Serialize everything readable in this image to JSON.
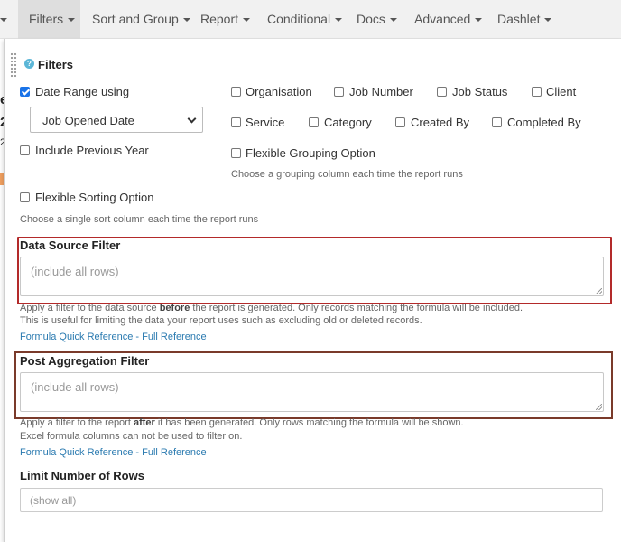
{
  "menubar": {
    "items": [
      {
        "label": "Filters"
      },
      {
        "label": "Sort and Group"
      },
      {
        "label": "Report"
      },
      {
        "label": "Conditional"
      },
      {
        "label": "Docs"
      },
      {
        "label": "Advanced"
      },
      {
        "label": "Dashlet"
      }
    ]
  },
  "panel": {
    "title": "Filters",
    "date_range": {
      "label": "Date Range using",
      "checked": true,
      "selected": "Job Opened Date"
    },
    "include_previous_year": "Include Previous Year",
    "flexible_sorting": "Flexible Sorting Option",
    "flexible_sorting_help": "Choose a single sort column each time the report runs",
    "columns": [
      {
        "label": "Organisation"
      },
      {
        "label": "Job Number"
      },
      {
        "label": "Job Status"
      },
      {
        "label": "Client"
      },
      {
        "label": "Service"
      },
      {
        "label": "Category"
      },
      {
        "label": "Created By"
      },
      {
        "label": "Completed By"
      }
    ],
    "flexible_grouping": "Flexible Grouping Option",
    "flexible_grouping_help": "Choose a grouping column each time the report runs",
    "data_source": {
      "title": "Data Source Filter",
      "placeholder": "(include all rows)",
      "help_pre": "Apply a filter to the data source ",
      "help_bold": "before",
      "help_post": " the report is generated. Only records matching the formula will be included.",
      "help_line2": "This is useful for limiting the data your report uses such as excluding old or deleted records.",
      "link_quick": "Formula Quick Reference",
      "link_sep": " - ",
      "link_full": "Full Reference"
    },
    "post_aggregation": {
      "title": "Post Aggregation Filter",
      "placeholder": "(include all rows)",
      "help_pre": "Apply a filter to the report ",
      "help_bold": "after",
      "help_post": " it has been generated. Only rows matching the formula will be shown.",
      "help_line2": "Excel formula columns can not be used to filter on.",
      "link_quick": "Formula Quick Reference",
      "link_sep": " - ",
      "link_full": "Full Reference"
    },
    "limit_rows": {
      "title": "Limit Number of Rows",
      "placeholder": "(show all)"
    }
  },
  "background_fragments": [
    "e",
    "2",
    "2"
  ],
  "colors": {
    "accent": "#1a73e8",
    "link": "#2a7ab0",
    "highlight_red": "#b32a2a",
    "highlight_brown": "#7a3a2a"
  }
}
